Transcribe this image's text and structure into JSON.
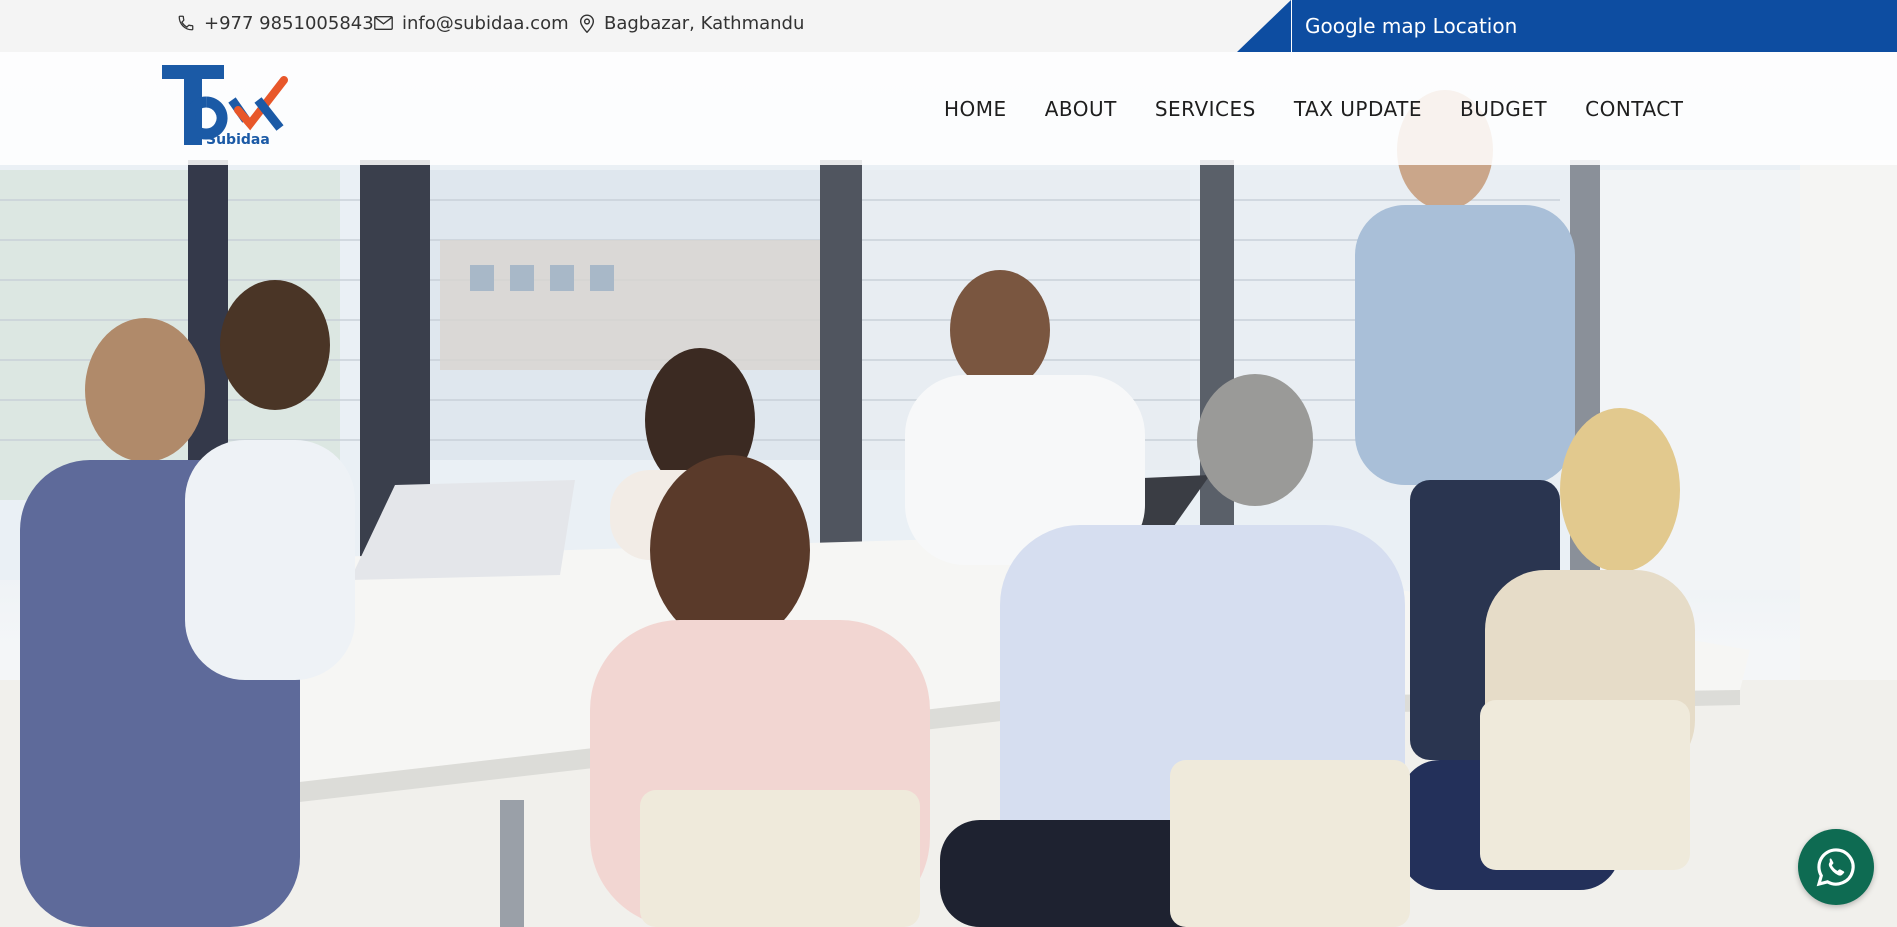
{
  "topbar": {
    "phone": "+977 9851005843",
    "email": "info@subidaa.com",
    "address": "Bagbazar, Kathmandu",
    "map_link_label": "Google map Location",
    "icons": [
      "phone-icon",
      "mail-icon",
      "location-pin-icon"
    ],
    "accent_color": "#0d4da1"
  },
  "logo": {
    "main_text": "Tax",
    "sub_text": "Subidaa",
    "colors": {
      "blue": "#1b5aa6",
      "orange": "#e8572a"
    }
  },
  "nav": {
    "items": [
      "HOME",
      "ABOUT",
      "SERVICES",
      "TAX UPDATE",
      "BUDGET",
      "CONTACT"
    ]
  },
  "floating": {
    "whatsapp_icon": "whatsapp-icon",
    "color": "#0e6b52"
  }
}
